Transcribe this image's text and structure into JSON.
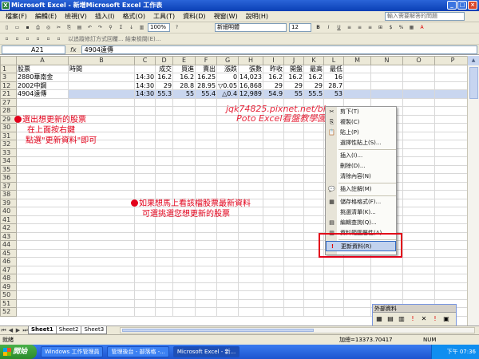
{
  "window": {
    "title": "Microsoft Excel - 新增Microsoft Excel 工作表"
  },
  "menu": [
    "檔案(F)",
    "編輯(E)",
    "檢視(V)",
    "插入(I)",
    "格式(O)",
    "工具(T)",
    "資料(D)",
    "視窗(W)",
    "說明(H)"
  ],
  "help_placeholder": "輸入需要解答的問題",
  "toolbar": {
    "font": "新細明體",
    "size": "12",
    "zoom": "100%",
    "toolbar2_text": "以追蹤修訂方式回覆...  結束檢閱(E)..."
  },
  "formula": {
    "name_box": "A21",
    "fx": "fx",
    "value": "4904遠傳"
  },
  "columns": [
    "A",
    "B",
    "C",
    "D",
    "E",
    "F",
    "G",
    "H",
    "I",
    "J",
    "K",
    "L",
    "M",
    "N",
    "O",
    "P"
  ],
  "rows": [
    {
      "num": "1",
      "cells": [
        "股票",
        "時間",
        "",
        "成交",
        "買進",
        "賣出",
        "漲跌",
        "張數",
        "昨收",
        "開盤",
        "最高",
        "最低",
        "",
        "",
        "",
        ""
      ],
      "selected": false
    },
    {
      "num": "3",
      "cells": [
        "2880華南金",
        "",
        "14:30",
        "16.2",
        "16.2",
        "16.25",
        "0",
        "14,023",
        "16.2",
        "16.2",
        "16.2",
        "16",
        "",
        "",
        "",
        ""
      ],
      "selected": false
    },
    {
      "num": "12",
      "cells": [
        "2002中鋼",
        "",
        "14:30",
        "29",
        "28.8",
        "28.95",
        "▽0.05",
        "16,868",
        "29",
        "29",
        "29",
        "28.7",
        "",
        "",
        "",
        ""
      ],
      "selected": false
    },
    {
      "num": "21",
      "cells": [
        "4904遠傳",
        "",
        "14:30",
        "55.3",
        "55",
        "55.4",
        "△0.4",
        "12,989",
        "54.9",
        "55",
        "55.5",
        "53",
        "",
        "",
        "",
        ""
      ],
      "selected": true
    },
    {
      "num": "27",
      "cells": [],
      "selected": false
    },
    {
      "num": "28",
      "cells": [],
      "selected": false
    },
    {
      "num": "29",
      "cells": [],
      "selected": false
    },
    {
      "num": "30",
      "cells": [],
      "selected": false
    },
    {
      "num": "31",
      "cells": [],
      "selected": false
    },
    {
      "num": "32",
      "cells": [],
      "selected": false
    },
    {
      "num": "33",
      "cells": [],
      "selected": false
    },
    {
      "num": "34",
      "cells": [],
      "selected": false
    },
    {
      "num": "35",
      "cells": [],
      "selected": false
    },
    {
      "num": "36",
      "cells": [],
      "selected": false
    },
    {
      "num": "37",
      "cells": [],
      "selected": false
    },
    {
      "num": "38",
      "cells": [],
      "selected": false
    },
    {
      "num": "39",
      "cells": [],
      "selected": false
    },
    {
      "num": "40",
      "cells": [],
      "selected": false
    },
    {
      "num": "41",
      "cells": [],
      "selected": false
    },
    {
      "num": "42",
      "cells": [],
      "selected": false
    },
    {
      "num": "43",
      "cells": [],
      "selected": false
    },
    {
      "num": "44",
      "cells": [],
      "selected": false
    },
    {
      "num": "45",
      "cells": [],
      "selected": false
    },
    {
      "num": "46",
      "cells": [],
      "selected": false
    },
    {
      "num": "47",
      "cells": [],
      "selected": false
    },
    {
      "num": "48",
      "cells": [],
      "selected": false
    },
    {
      "num": "49",
      "cells": [],
      "selected": false
    },
    {
      "num": "50",
      "cells": [],
      "selected": false
    },
    {
      "num": "51",
      "cells": [],
      "selected": false
    },
    {
      "num": "52",
      "cells": [],
      "selected": false
    }
  ],
  "annotations": {
    "left_line1": "選出想更新的股票",
    "left_line2": "在上面按右鍵",
    "left_line3": "點選\"更新資料\"即可",
    "mid_line1": "如果想馬上看該檔股票最新資料",
    "mid_line2": "可選挑選您想更新的股票"
  },
  "watermark": {
    "line1": "jqk74825.pixnet.net/blog",
    "line2": "Poto Excel看盤教學園"
  },
  "context_menu": [
    {
      "label": "剪下(T)",
      "icon": "✂"
    },
    {
      "label": "複製(C)",
      "icon": "⎘"
    },
    {
      "label": "貼上(P)",
      "icon": "📋"
    },
    {
      "label": "選擇性貼上(S)...",
      "icon": ""
    },
    {
      "sep": true
    },
    {
      "label": "插入(I)...",
      "icon": ""
    },
    {
      "label": "刪除(D)...",
      "icon": ""
    },
    {
      "label": "清除內容(N)",
      "icon": ""
    },
    {
      "sep": true
    },
    {
      "label": "插入註解(M)",
      "icon": "💬"
    },
    {
      "sep": true
    },
    {
      "label": "儲存格格式(F)...",
      "icon": "▦"
    },
    {
      "label": "挑選清單(K)...",
      "icon": ""
    },
    {
      "label": "編輯查詢(Q)...",
      "icon": "▤"
    },
    {
      "label": "資料範圍屬性(A)...",
      "icon": "▥"
    },
    {
      "sep": true
    },
    {
      "label": "更新資料(R)",
      "icon": "!",
      "highlight": true
    }
  ],
  "ext_panel": {
    "title": "外部資料"
  },
  "sheets": [
    "Sheet1",
    "Sheet2",
    "Sheet3"
  ],
  "status": {
    "left": "就緒",
    "sum": "加總=13373.70417",
    "mode": "NUM"
  },
  "taskbar": {
    "start": "開始",
    "tasks": [
      "Windows 工作管理員",
      "管理後台 - 部落格 -...",
      "Microsoft Excel - 新..."
    ],
    "clock": "下午 07:36"
  },
  "colors": {
    "accent_red": "#e2001a",
    "title_blue": "#0a3fb5"
  }
}
